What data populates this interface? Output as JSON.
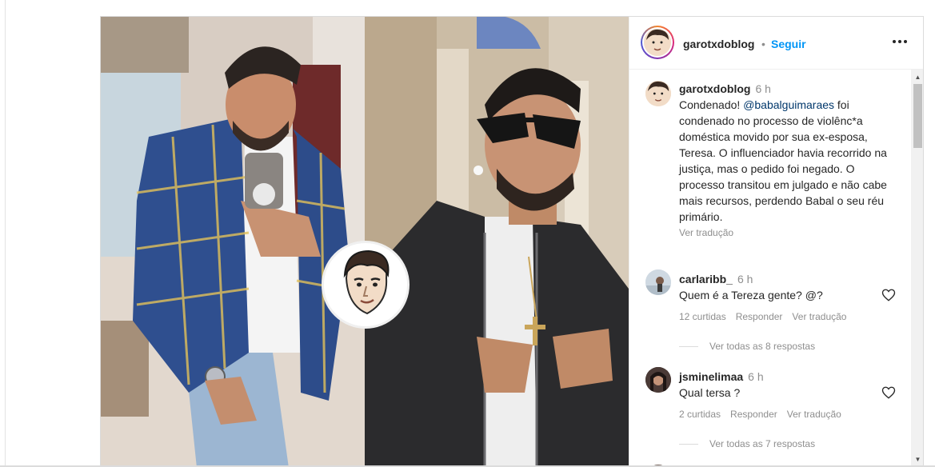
{
  "post": {
    "author": "garotxdoblog",
    "separator": "•",
    "follow_label": "Seguir",
    "more_label": "•••",
    "caption": {
      "username": "garotxdoblog",
      "time": "6 h",
      "text_before": "Condenado! ",
      "mention": "@babalguimaraes",
      "text_after": " foi condenado no processo de violênc*a doméstica movido por sua ex-esposa, Teresa. O influenciador havia recorrido na justiça, mas o pedido foi negado. O processo transitou em julgado e não cabe mais recursos, perdendo Babal o seu réu primário.",
      "translate": "Ver tradução"
    },
    "comments": [
      {
        "username": "carlaribb_",
        "time": "6 h",
        "text": "Quem é a Tereza gente? @?",
        "likes": "12 curtidas",
        "reply": "Responder",
        "translate": "Ver tradução",
        "view_replies": "Ver todas as 8 respostas"
      },
      {
        "username": "jsminelimaa",
        "time": "6 h",
        "text": "Qual tersa ?",
        "likes": "2 curtidas",
        "reply": "Responder",
        "translate": "Ver tradução",
        "view_replies": "Ver todas as 7 respostas"
      }
    ]
  },
  "icons": {
    "more": "more-horizontal-icon",
    "heart": "heart-outline-icon",
    "scroll_up": "scroll-up-arrow-icon",
    "scroll_down": "scroll-down-arrow-icon"
  },
  "colors": {
    "link_blue": "#0095f6",
    "mention": "#00376b",
    "muted": "#8e8e8e",
    "text": "#262626"
  }
}
